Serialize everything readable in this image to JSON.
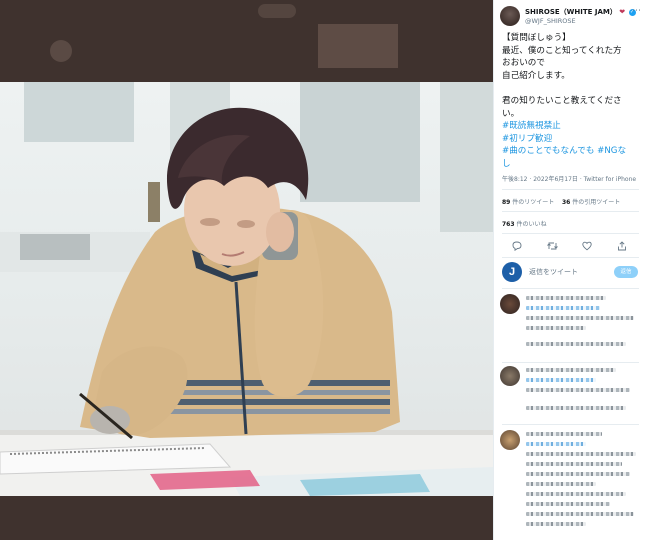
{
  "tweet": {
    "display_name": "SHIROSE（WHITE JAM）",
    "handle": "@WJF_SHIROSE",
    "lines": [
      "【質問ぼしゅう】",
      "最近、僕のこと知ってくれた方",
      "おおいので",
      "自己紹介します。"
    ],
    "lines2": [
      "君の知りたいこと教えてくださ",
      "い。"
    ],
    "hashtags": [
      "#既読無視禁止",
      "#初リプ歓迎",
      "#曲のことでもなんでも #NGな",
      "し"
    ],
    "meta": "午後8:12 · 2022年6月17日 · Twitter for iPhone",
    "retweets_count": "89",
    "retweets_label": "件のリツイート",
    "quotes_count": "36",
    "quotes_label": "件の引用ツイート",
    "likes_count": "763",
    "likes_label": "件のいいね"
  },
  "reply_box": {
    "placeholder": "返信をツイート",
    "avatar_letter": "J",
    "button_label": "返信"
  },
  "colors": {
    "accent": "#1da1f2",
    "link": "#1b95e0",
    "overlay": "#3d302c"
  },
  "icons": [
    "more-icon",
    "verified-icon",
    "reply-icon",
    "retweet-icon",
    "like-icon",
    "share-icon"
  ]
}
